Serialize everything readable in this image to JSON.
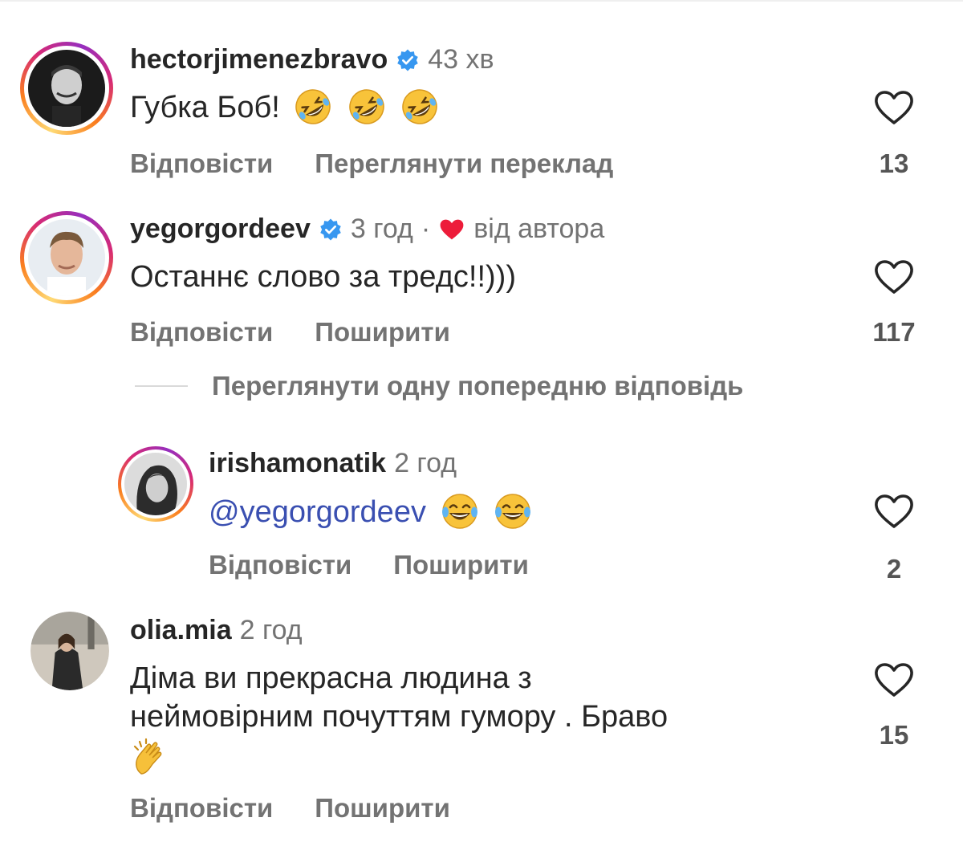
{
  "comments": [
    {
      "username": "hectorjimenezbravo",
      "verified": true,
      "time": "43 хв",
      "text": "Губка Боб!",
      "emoji": [
        "rolling-laughing",
        "rolling-laughing",
        "rolling-laughing"
      ],
      "actions": [
        "Відповісти",
        "Переглянути переклад"
      ],
      "likes": "13"
    },
    {
      "username": "yegorgordeev",
      "verified": true,
      "time": "3 год",
      "separator": "·",
      "author_like_label": "від автора",
      "text": "Останнє слово за тредс!!)))",
      "actions": [
        "Відповісти",
        "Поширити"
      ],
      "likes": "117"
    },
    {
      "username": "irishamonatik",
      "verified": false,
      "time": "2 год",
      "mention": "@yegorgordeev",
      "emoji": [
        "tears-of-joy",
        "tears-of-joy"
      ],
      "actions": [
        "Відповісти",
        "Поширити"
      ],
      "likes": "2"
    },
    {
      "username": "olia.mia",
      "verified": false,
      "time": "2 год",
      "text_lines": [
        "Діма ви прекрасна людина з",
        "неймовірним почуттям гумору . Браво"
      ],
      "emoji": [
        "clapping-hands"
      ],
      "actions": [
        "Відповісти",
        "Поширити"
      ],
      "likes": "15"
    }
  ],
  "view_previous_replies": "Переглянути одну попередню відповідь",
  "colors": {
    "verified": "#3797f0",
    "heart_red": "#ed1c3a",
    "mention": "#3a4fb1",
    "secondary_text": "#737373"
  }
}
